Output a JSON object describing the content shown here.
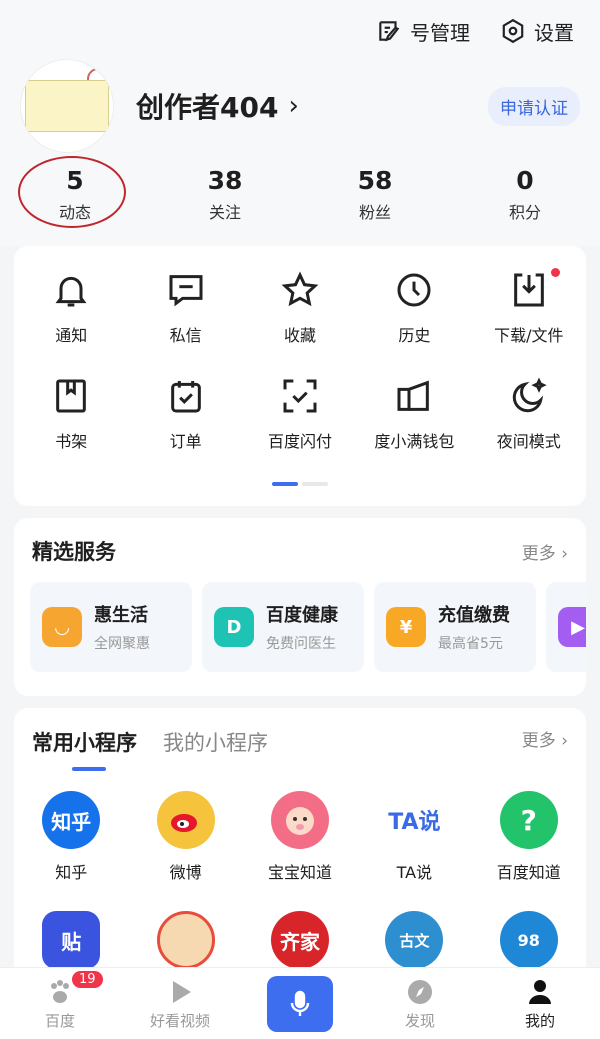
{
  "header": {
    "account_manage": "号管理",
    "settings": "设置"
  },
  "profile": {
    "name": "创作者404",
    "chevron": "›",
    "apply_label": "申请认证"
  },
  "stats": [
    {
      "num": "5",
      "label": "动态"
    },
    {
      "num": "38",
      "label": "关注"
    },
    {
      "num": "58",
      "label": "粉丝"
    },
    {
      "num": "0",
      "label": "积分"
    }
  ],
  "tools": [
    {
      "label": "通知",
      "icon": "bell-icon"
    },
    {
      "label": "私信",
      "icon": "message-icon"
    },
    {
      "label": "收藏",
      "icon": "star-icon"
    },
    {
      "label": "历史",
      "icon": "clock-icon"
    },
    {
      "label": "下载/文件",
      "icon": "download-icon"
    },
    {
      "label": "书架",
      "icon": "bookshelf-icon"
    },
    {
      "label": "订单",
      "icon": "order-icon"
    },
    {
      "label": "百度闪付",
      "icon": "scan-pay-icon"
    },
    {
      "label": "度小满钱包",
      "icon": "wallet-icon"
    },
    {
      "label": "夜间模式",
      "icon": "moon-icon"
    }
  ],
  "services": {
    "title": "精选服务",
    "more": "更多",
    "items": [
      {
        "title": "惠生活",
        "sub": "全网聚惠",
        "color": "#f7a531"
      },
      {
        "title": "百度健康",
        "sub": "免费问医生",
        "color": "#1fc3b4"
      },
      {
        "title": "充值缴费",
        "sub": "最高省5元",
        "color": "#f9a825"
      }
    ]
  },
  "miniprograms": {
    "tab_common": "常用小程序",
    "tab_mine": "我的小程序",
    "more": "更多",
    "apps": [
      {
        "label": "知乎",
        "text": "知乎",
        "color": "#1672ea"
      },
      {
        "label": "微博",
        "text": "",
        "color": "#f5c33c"
      },
      {
        "label": "宝宝知道",
        "text": "",
        "color": "#f36d87"
      },
      {
        "label": "TA说",
        "text": "TA说",
        "color": "#ffffff"
      },
      {
        "label": "百度知道",
        "text": "?",
        "color": "#22c36a"
      },
      {
        "label": "",
        "text": "贴",
        "color": "#3a54e0"
      },
      {
        "label": "",
        "text": "",
        "color": "#e94b3c"
      },
      {
        "label": "",
        "text": "齐家",
        "color": "#d8252a"
      },
      {
        "label": "",
        "text": "古文",
        "color": "#2d8fd0"
      },
      {
        "label": "",
        "text": "98",
        "color": "#1e88d6"
      }
    ]
  },
  "tabbar": [
    {
      "label": "百度",
      "badge": "19"
    },
    {
      "label": "好看视频"
    },
    {
      "label": ""
    },
    {
      "label": "发现"
    },
    {
      "label": "我的"
    }
  ]
}
